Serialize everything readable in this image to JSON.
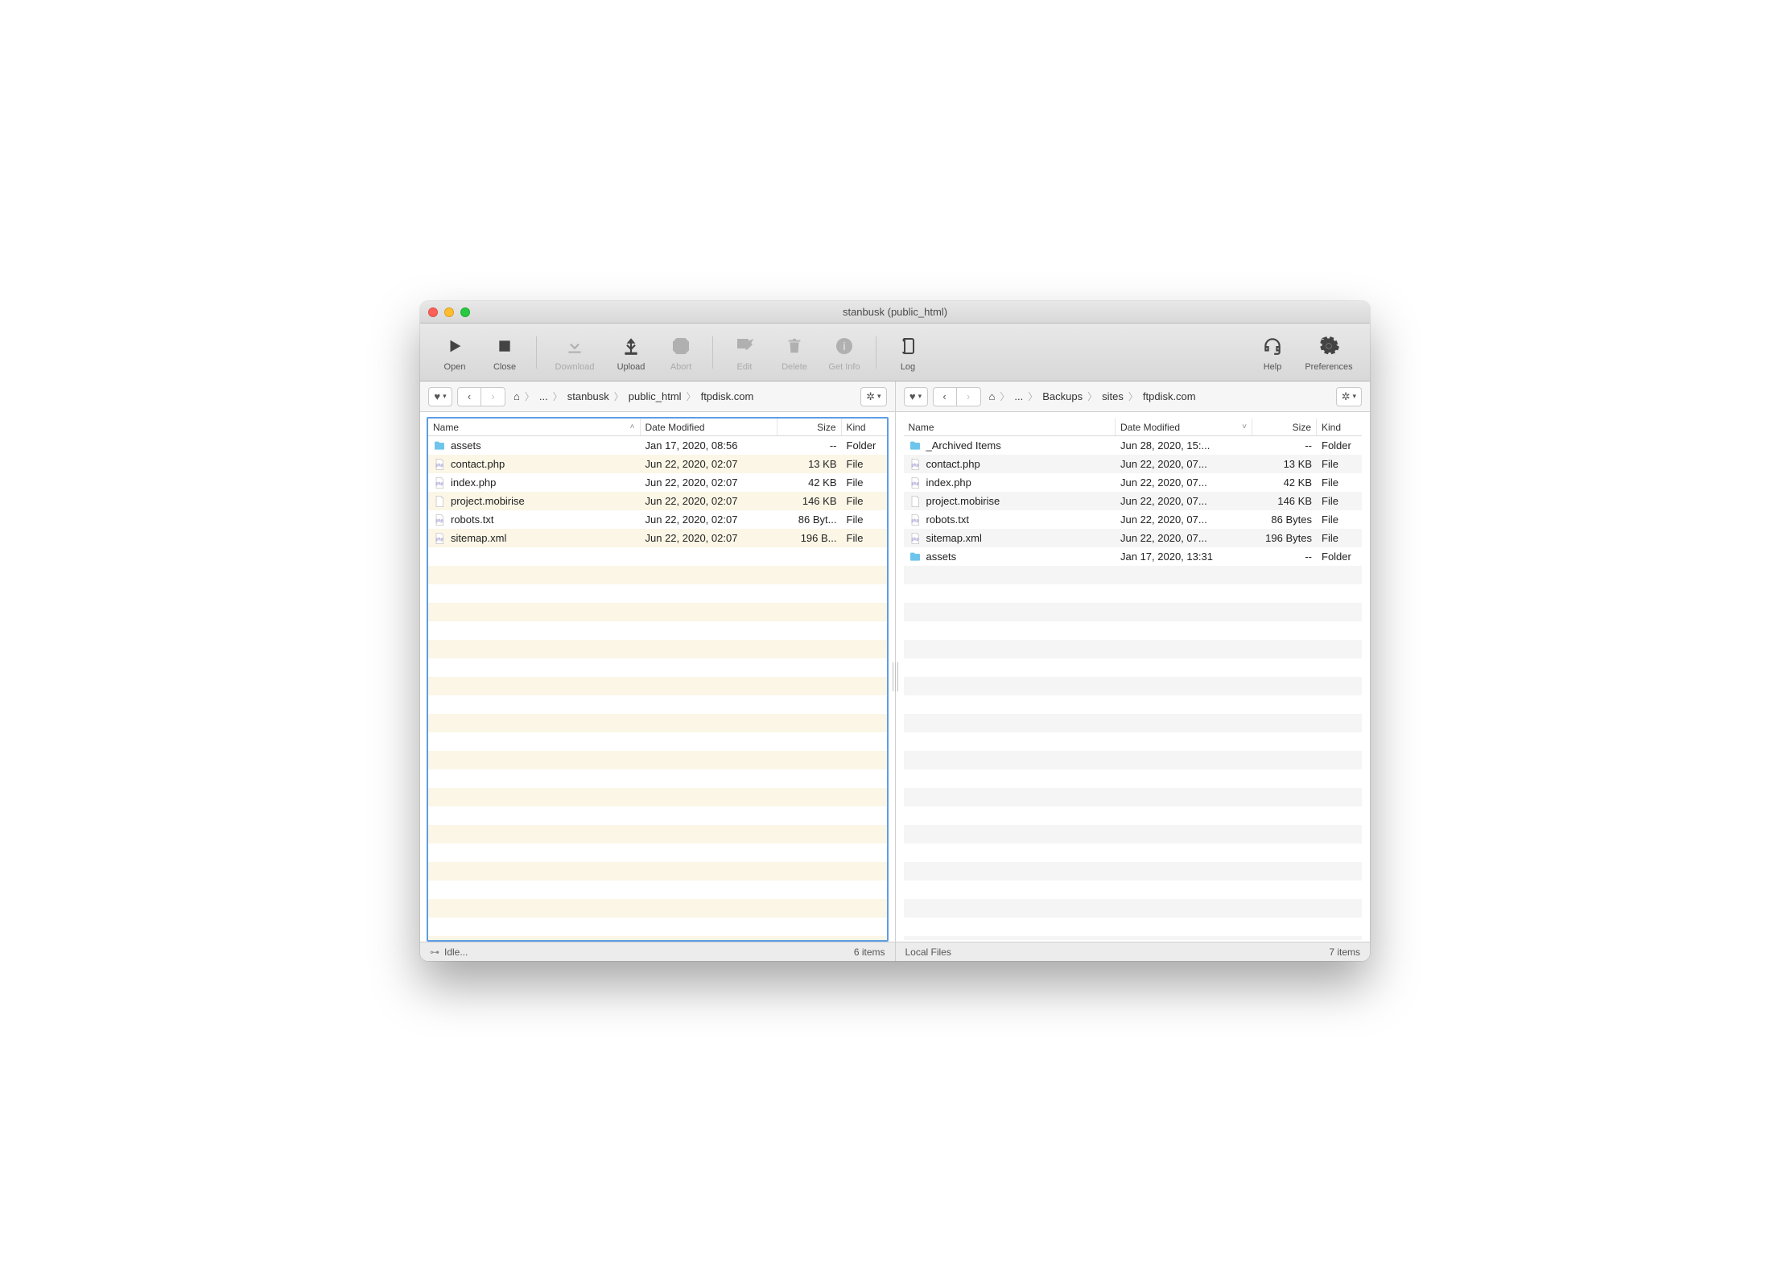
{
  "window": {
    "title": "stanbusk (public_html)"
  },
  "toolbar": {
    "open": "Open",
    "close": "Close",
    "download": "Download",
    "upload": "Upload",
    "abort": "Abort",
    "edit": "Edit",
    "delete": "Delete",
    "getinfo": "Get Info",
    "log": "Log",
    "help": "Help",
    "preferences": "Preferences"
  },
  "columns": {
    "name": "Name",
    "date": "Date Modified",
    "size": "Size",
    "kind": "Kind"
  },
  "left": {
    "breadcrumbs": [
      "stanbusk",
      "public_html",
      "ftpdisk.com"
    ],
    "status_left": "Idle...",
    "status_right": "6 items",
    "files": [
      {
        "icon": "folder",
        "name": "assets",
        "date": "Jan 17, 2020, 08:56",
        "size": "--",
        "kind": "Folder"
      },
      {
        "icon": "php",
        "name": "contact.php",
        "date": "Jun 22, 2020, 02:07",
        "size": "13 KB",
        "kind": "File"
      },
      {
        "icon": "php",
        "name": "index.php",
        "date": "Jun 22, 2020, 02:07",
        "size": "42 KB",
        "kind": "File"
      },
      {
        "icon": "doc",
        "name": "project.mobirise",
        "date": "Jun 22, 2020, 02:07",
        "size": "146 KB",
        "kind": "File"
      },
      {
        "icon": "php",
        "name": "robots.txt",
        "date": "Jun 22, 2020, 02:07",
        "size": "86 Byt...",
        "kind": "File"
      },
      {
        "icon": "php",
        "name": "sitemap.xml",
        "date": "Jun 22, 2020, 02:07",
        "size": "196 B...",
        "kind": "File"
      }
    ]
  },
  "right": {
    "breadcrumbs": [
      "Backups",
      "sites",
      "ftpdisk.com"
    ],
    "status_left": "Local Files",
    "status_right": "7 items",
    "files": [
      {
        "icon": "folder",
        "name": "_Archived Items",
        "date": "Jun 28, 2020, 15:...",
        "size": "--",
        "kind": "Folder"
      },
      {
        "icon": "php",
        "name": "contact.php",
        "date": "Jun 22, 2020, 07...",
        "size": "13 KB",
        "kind": "File"
      },
      {
        "icon": "php",
        "name": "index.php",
        "date": "Jun 22, 2020, 07...",
        "size": "42 KB",
        "kind": "File"
      },
      {
        "icon": "doc",
        "name": "project.mobirise",
        "date": "Jun 22, 2020, 07...",
        "size": "146 KB",
        "kind": "File"
      },
      {
        "icon": "php",
        "name": "robots.txt",
        "date": "Jun 22, 2020, 07...",
        "size": "86 Bytes",
        "kind": "File"
      },
      {
        "icon": "php",
        "name": "sitemap.xml",
        "date": "Jun 22, 2020, 07...",
        "size": "196 Bytes",
        "kind": "File"
      },
      {
        "icon": "folder",
        "name": "assets",
        "date": "Jan 17, 2020, 13:31",
        "size": "--",
        "kind": "Folder"
      }
    ]
  }
}
